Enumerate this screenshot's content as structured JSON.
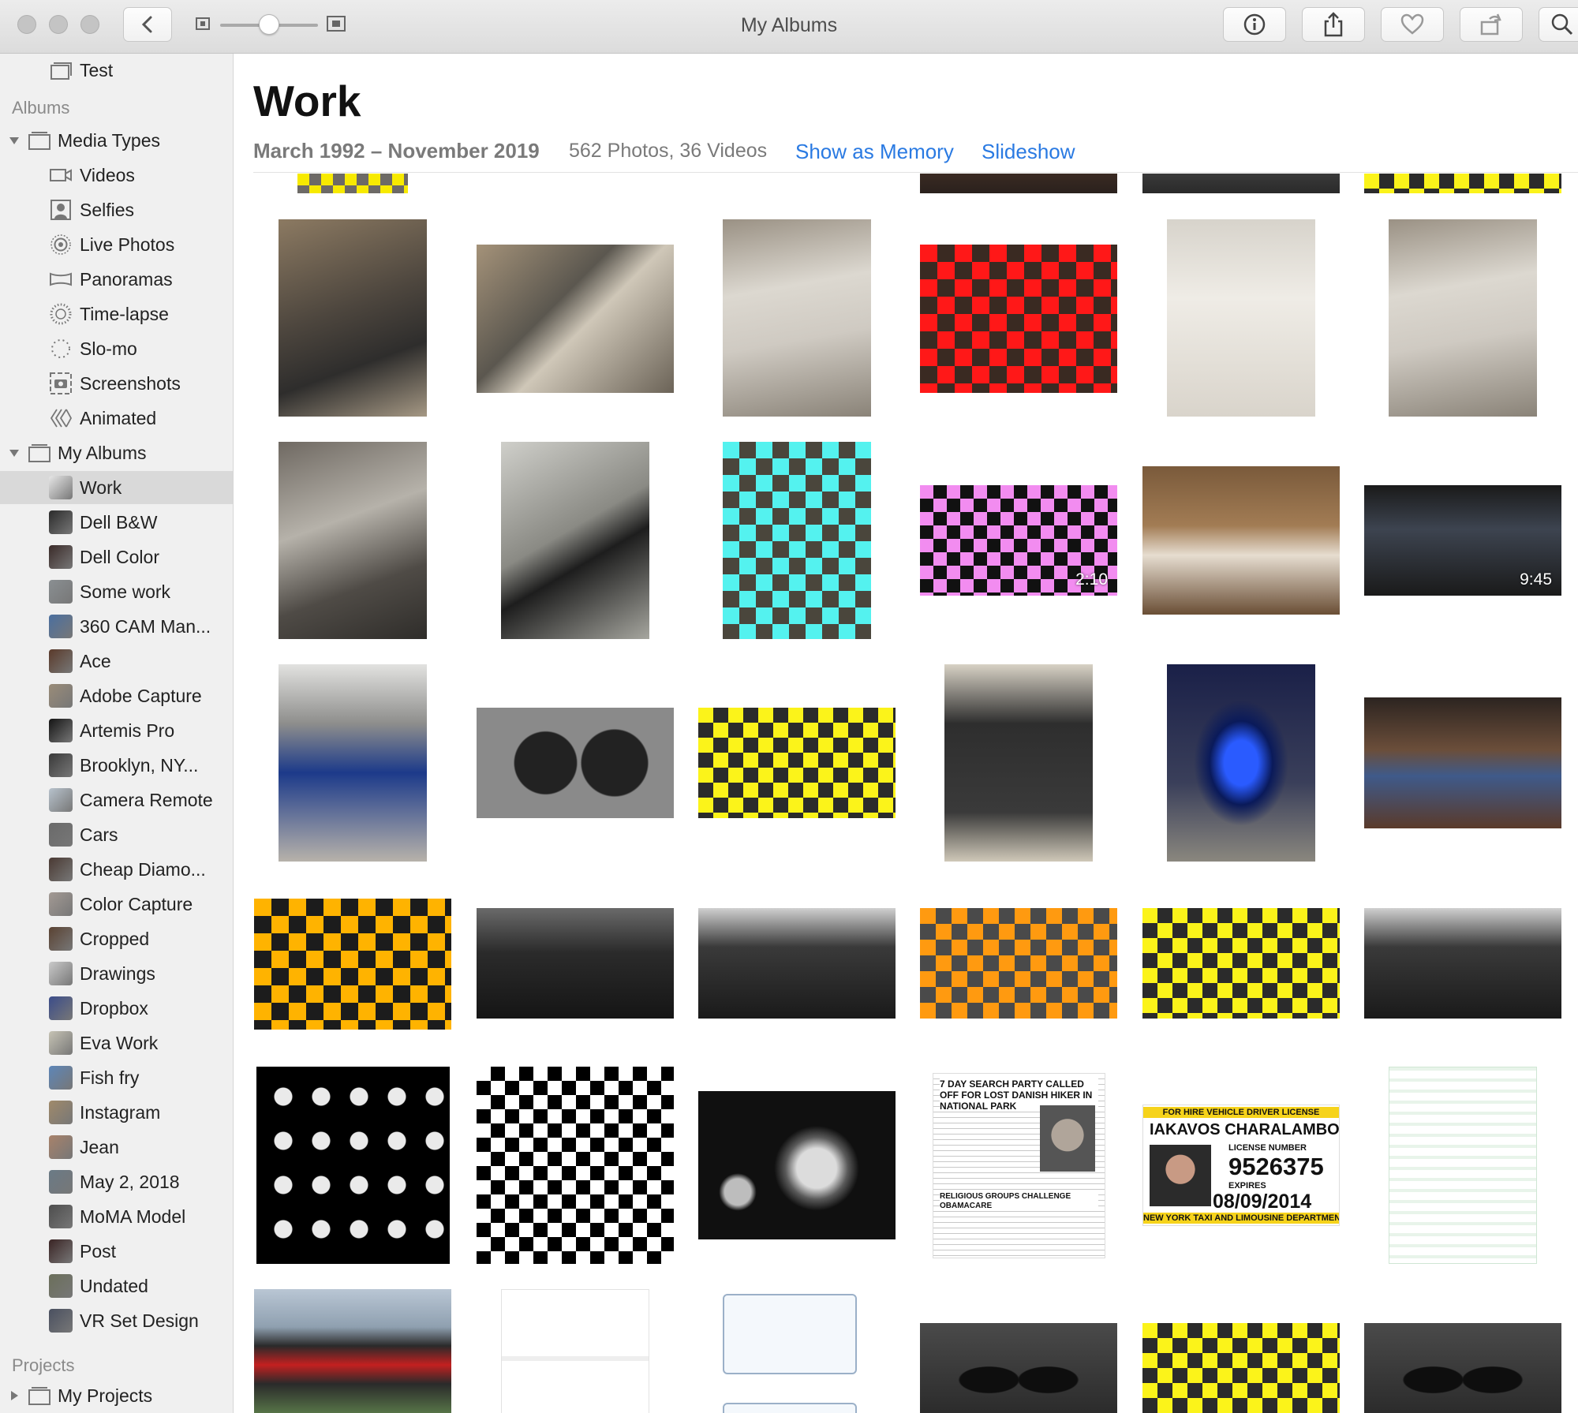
{
  "window": {
    "title": "My Albums"
  },
  "sidebar": {
    "top_item": "Test",
    "albums_header": "Albums",
    "media_types": {
      "label": "Media Types",
      "items": [
        "Videos",
        "Selfies",
        "Live Photos",
        "Panoramas",
        "Time-lapse",
        "Slo-mo",
        "Screenshots",
        "Animated"
      ]
    },
    "my_albums": {
      "label": "My Albums",
      "items": [
        "Work",
        "Dell B&W",
        "Dell Color",
        "Some work",
        "360 CAM Man...",
        "Ace",
        "Adobe Capture",
        "Artemis Pro",
        "Brooklyn, NY...",
        "Camera Remote",
        "Cars",
        "Cheap Diamo...",
        "Color Capture",
        "Cropped",
        "Drawings",
        "Dropbox",
        "Eva Work",
        "Fish fry",
        "Instagram",
        "Jean",
        "May 2, 2018",
        "MoMA Model",
        "Post",
        "Undated",
        "VR Set Design"
      ],
      "selected": "Work"
    },
    "projects_header": "Projects",
    "projects": {
      "label": "My Projects"
    }
  },
  "album": {
    "title": "Work",
    "date_range": "March 1992 – November 2019",
    "counts": "562 Photos, 36 Videos",
    "show_as_memory": "Show as Memory",
    "slideshow": "Slideshow"
  },
  "video_durations": {
    "pink_checker": "2:10",
    "monitor": "9:45"
  },
  "license": {
    "header": "FOR HIRE VEHICLE DRIVER LICENSE",
    "name": "IAKAVOS CHARALAMBOS",
    "number_label": "LICENSE NUMBER",
    "number": "9526375",
    "expires_label": "EXPIRES",
    "expires": "08/09/2014",
    "footer": "NEW YORK TAXI AND LIMOUSINE DEPARTMENT"
  },
  "newspaper": {
    "headline": "7 DAY SEARCH PARTY CALLED OFF FOR LOST DANISH HIKER IN NATIONAL PARK",
    "subhead": "RELIGIOUS GROUPS CHALLENGE OBAMACARE"
  },
  "colors": {
    "accent_link": "#2a7ae2",
    "sidebar_bg": "#f0f0f0",
    "selected_row": "#d9d9d9"
  }
}
